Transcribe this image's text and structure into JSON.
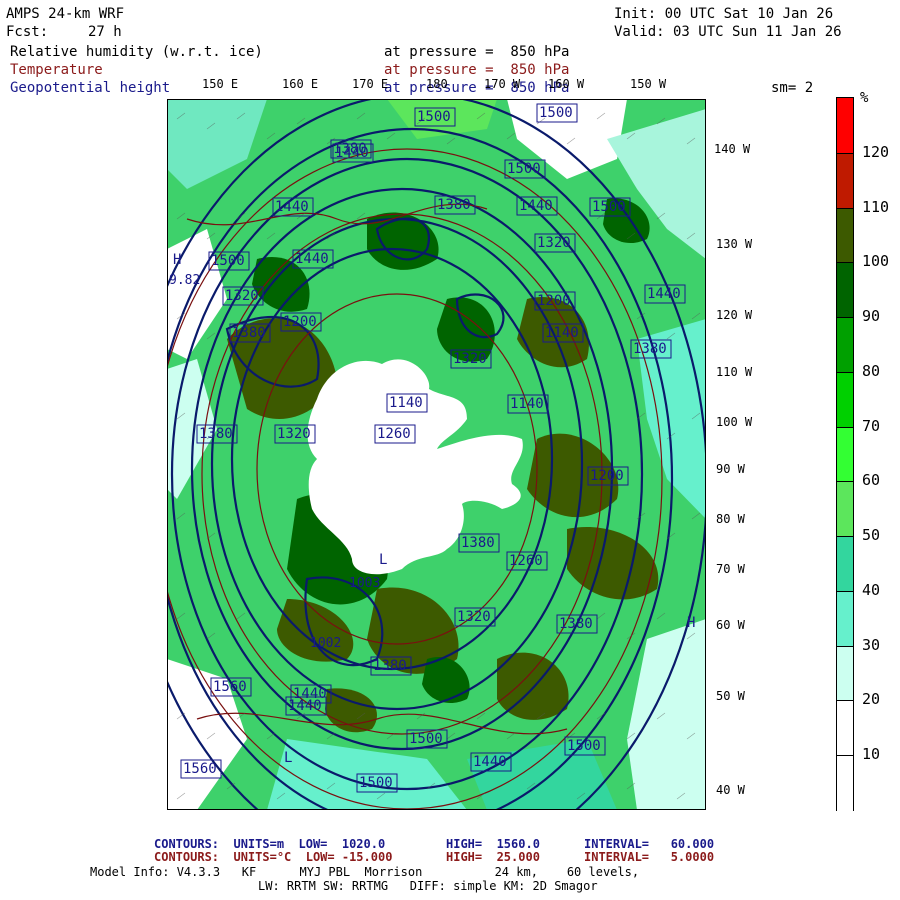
{
  "header": {
    "model": "AMPS 24-km WRF",
    "fcst_label": "Fcst:",
    "fcst_value": "27 h",
    "init": "Init: 00 UTC Sat 10 Jan 26",
    "valid": "Valid: 03 UTC Sun 11 Jan 26"
  },
  "fields": [
    {
      "name": "Relative humidity (w.r.t. ice)",
      "level": "at pressure =  850 hPa",
      "color": "#000000"
    },
    {
      "name": "Temperature",
      "level": "at pressure =  850 hPa",
      "color": "#8b1a1a"
    },
    {
      "name": "Geopotential height",
      "level": "at pressure =  850 hPa",
      "color": "#1a1a8b"
    }
  ],
  "smoothing": "sm= 2",
  "top_lon_labels": [
    "150 E",
    "160 E",
    "170 E",
    "180",
    "170 W",
    "160 W",
    "150 W"
  ],
  "right_lon_labels": [
    "140 W",
    "130 W",
    "120 W",
    "110 W",
    "100 W",
    "90 W",
    "80 W",
    "70 W",
    "60 W",
    "50 W",
    "40 W"
  ],
  "legend": {
    "unit": "%",
    "labels": [
      "120",
      "110",
      "100",
      "90",
      "80",
      "70",
      "60",
      "50",
      "40",
      "30",
      "20",
      "10"
    ],
    "colors": [
      "#ff0000",
      "#bf1a00",
      "#3d5a00",
      "#006400",
      "#00a000",
      "#00d000",
      "#33ff33",
      "#5ce65c",
      "#33d69e",
      "#66f0cc",
      "#ccfff0",
      "#ffffff",
      "#ffffff"
    ]
  },
  "map_labels": {
    "contour_heights": [
      "1500",
      "1500",
      "1440",
      "1500",
      "1440",
      "1380",
      "1440",
      "1500",
      "1380",
      "1320",
      "1440",
      "1500",
      "1440",
      "1320",
      "1380",
      "1200",
      "1140",
      "1200",
      "1380",
      "1320",
      "1140",
      "1260",
      "1380",
      "1320",
      "1380",
      "1260",
      "1200",
      "1140",
      "1380",
      "1320",
      "1500",
      "1560",
      "1440",
      "1380",
      "1500",
      "1560",
      "1500",
      "1440",
      "1440"
    ],
    "markers": [
      "H",
      "L",
      "H",
      "L"
    ],
    "values": [
      "9.82",
      "1002",
      "1003"
    ]
  },
  "footer": {
    "line1_label": "CONTOURS:  UNITS=m  LOW=  1020.0",
    "line1_high": "HIGH=  1560.0",
    "line1_int": "INTERVAL=   60.000",
    "line2_label": "CONTOURS:  UNITS=°C  LOW= -15.000",
    "line2_high": "HIGH=  25.000",
    "line2_int": "INTERVAL=   5.0000",
    "model_info": "Model Info: V4.3.3   KF      MYJ PBL  Morrison          24 km,    60 levels,",
    "model_info2": "LW: RRTM SW: RRTMG   DIFF: simple KM: 2D Smagor"
  }
}
